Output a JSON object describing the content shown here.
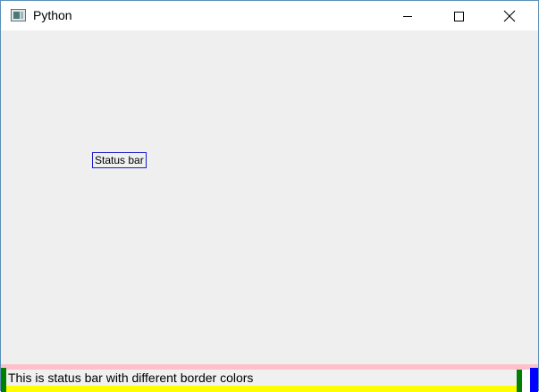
{
  "window": {
    "title": "Python",
    "app_icon": "tk-window-icon",
    "controls": {
      "minimize_icon": "minimize-icon",
      "maximize_icon": "maximize-icon",
      "close_icon": "close-icon"
    }
  },
  "content": {
    "label_text": "Status bar",
    "label_border_color": "#1a1acc"
  },
  "statusbar": {
    "text": "This is status bar with different border colors",
    "border_colors": {
      "top": "#ffc0cb",
      "left": "#008000",
      "right": "#0000ff",
      "inner_right": "#008000",
      "bottom": "#ffff00"
    }
  }
}
